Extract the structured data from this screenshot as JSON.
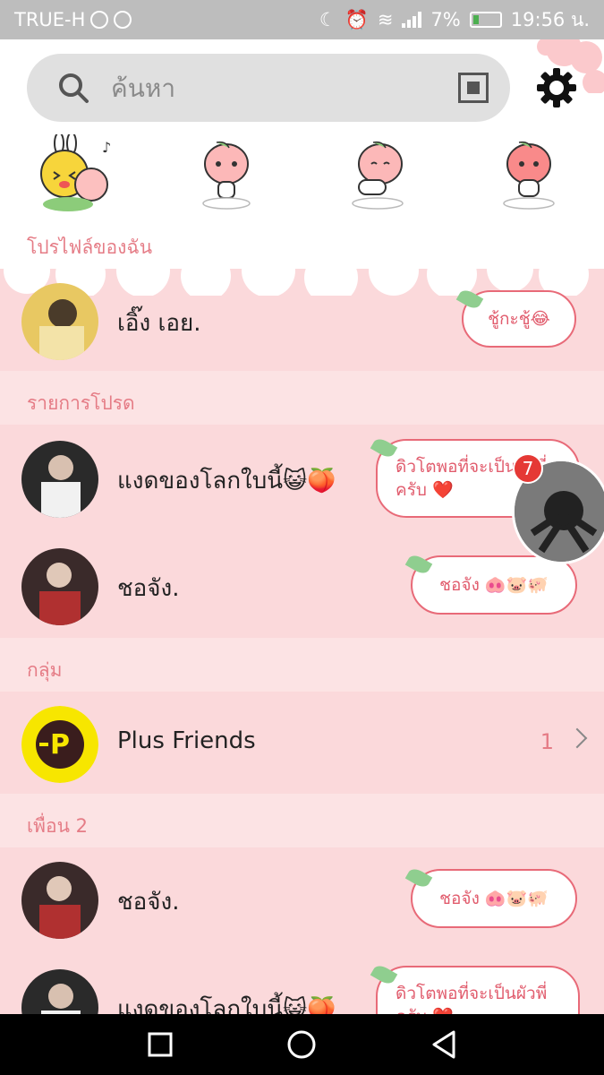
{
  "status_bar": {
    "carrier": "TRUE-H",
    "battery": "7%",
    "time": "19:56 น."
  },
  "search": {
    "placeholder": "ค้นหา"
  },
  "sections": {
    "my_profile": "โปรไฟล์ของฉัน",
    "favorites": "รายการโปรด",
    "groups": "กลุ่ม",
    "friends": "เพื่อน 2"
  },
  "profile": {
    "name": "เอิ๊ง เอย.",
    "status": "ชู้กะชู้😂"
  },
  "favorites": [
    {
      "name": "แงดของโลกใบนี้😺🍑",
      "status": "ดิวโตพอที่จะเป็นผัวพี่ครับ ❤️"
    },
    {
      "name": "ชอจัง.",
      "status": "ชอจัง 🐽🐷🐖"
    }
  ],
  "groups": [
    {
      "name": "Plus Friends",
      "count": "1"
    }
  ],
  "friends": [
    {
      "name": "ชอจัง.",
      "status": "ชอจัง 🐽🐷🐖"
    },
    {
      "name": "แงดของโลกใบนี้😺🍑",
      "status": "ดิวโตพอที่จะเป็นผัวพี่ครับ ❤️"
    }
  ],
  "chat_head": {
    "badge": "7"
  },
  "colors": {
    "accent": "#e57c86",
    "background": "#fbd9db",
    "bubble_border": "#e86a78",
    "plus_friends_yellow": "#f7e600"
  }
}
